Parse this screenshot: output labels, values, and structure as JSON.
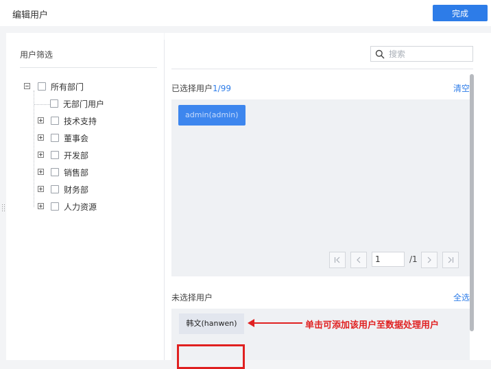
{
  "header": {
    "title": "编辑用户",
    "done_label": "完成"
  },
  "filter": {
    "title": "用户筛选",
    "root": {
      "label": "所有部门"
    },
    "children": [
      {
        "label": "无部门用户"
      },
      {
        "label": "技术支持"
      },
      {
        "label": "董事会"
      },
      {
        "label": "开发部"
      },
      {
        "label": "销售部"
      },
      {
        "label": "财务部"
      },
      {
        "label": "人力资源"
      }
    ]
  },
  "search": {
    "placeholder": "搜索",
    "value": ""
  },
  "selected": {
    "label_prefix": "已选择用户",
    "count_text": "1/99",
    "clear_label": "清空",
    "users": [
      "admin(admin)"
    ]
  },
  "pager": {
    "current_page": "1",
    "total_text": "/1"
  },
  "unselected": {
    "label": "未选择用户",
    "select_all_label": "全选",
    "users": [
      "韩文(hanwen)"
    ]
  },
  "annotation": {
    "text": "单击可添加该用户至数据处理用户",
    "color": "#e02020"
  },
  "colors": {
    "accent": "#2d7ce8",
    "selected_chip": "#3d86ee",
    "annotation": "#e02020"
  }
}
